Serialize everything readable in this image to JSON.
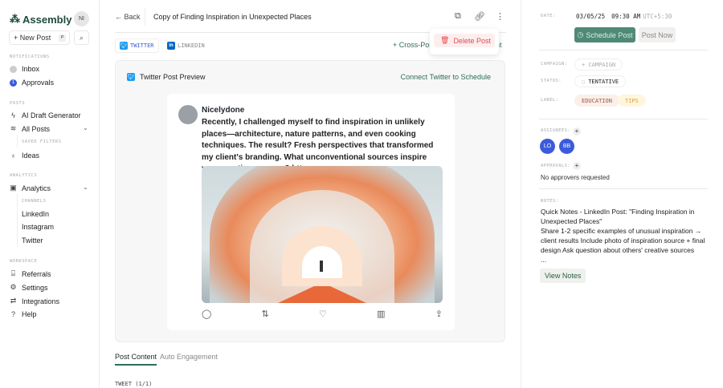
{
  "sidebar": {
    "brand": "Assembly",
    "user_initials": "NI",
    "new_post": "+ New Post",
    "new_post_shortcut": "P",
    "notifications_heading": "NOTIFICATIONS",
    "inbox": "Inbox",
    "approvals": "Approvals",
    "approvals_count": "1",
    "posts_heading": "POSTS",
    "ai_draft": "AI Draft Generator",
    "all_posts": "All Posts",
    "saved_filters": "SAVED FILTERS",
    "ideas": "Ideas",
    "analytics_heading": "ANALYTICS",
    "analytics": "Analytics",
    "channels_heading": "CHANNELS",
    "channels": [
      "LinkedIn",
      "Instagram",
      "Twitter"
    ],
    "workspace_heading": "WORKSPACE",
    "referrals": "Referrals",
    "settings": "Settings",
    "integrations": "Integrations",
    "help": "Help"
  },
  "header": {
    "back": "Back",
    "title": "Copy of Finding Inspiration in Unexpected Places",
    "menu_delete": "Delete Post"
  },
  "platforms": {
    "twitter": "TWITTER",
    "linkedin": "LINKEDIN",
    "cross_post": "+ Cross-Post",
    "cross_post_tail": "nt"
  },
  "preview": {
    "title": "Twitter Post Preview",
    "connect": "Connect Twitter to Schedule",
    "username": "Nicelydone",
    "text": "Recently, I challenged myself to find inspiration in unlikely places—architecture, nature patterns, and even cooking techniques. The result? Fresh perspectives that transformed my client's branding. What unconventional sources inspire your creative process? https"
  },
  "tabs": {
    "post_content": "Post Content",
    "auto_engagement": "Auto Engagement",
    "tweet_label": "TWEET (1/1)"
  },
  "details": {
    "date_label": "DATE:",
    "date": "03/05/25",
    "time": "09:30 AM",
    "timezone": "UTC+5:30",
    "schedule": "Schedule Post",
    "post_now": "Post Now",
    "campaign_label": "CAMPAIGN:",
    "campaign": "+ CAMPAIGN",
    "status_label": "STATUS:",
    "status": "TENTATIVE",
    "label_label": "LABEL:",
    "labels": [
      "EDUCATION",
      "TIPS"
    ],
    "assignees_label": "ASSIGNEES:",
    "assignees": [
      "LO",
      "BB"
    ],
    "approvals_label": "APPROVALS:",
    "approvals_text": "No approvers requested",
    "notes_label": "NOTES:",
    "notes": "Quick Notes - LinkedIn Post: \"Finding Inspiration in Unexpected Places\"\nShare 1-2 specific examples of unusual inspiration → client results Include photo of inspiration source + final design Ask question about others' creative sources\n...",
    "view_notes": "View Notes"
  },
  "colors": {
    "brand": "#1e4a3d",
    "schedule_bg": "#4f8a76",
    "accent_green": "#2f6b57",
    "danger": "#e5484d",
    "assignee": "#3b5bdb"
  }
}
